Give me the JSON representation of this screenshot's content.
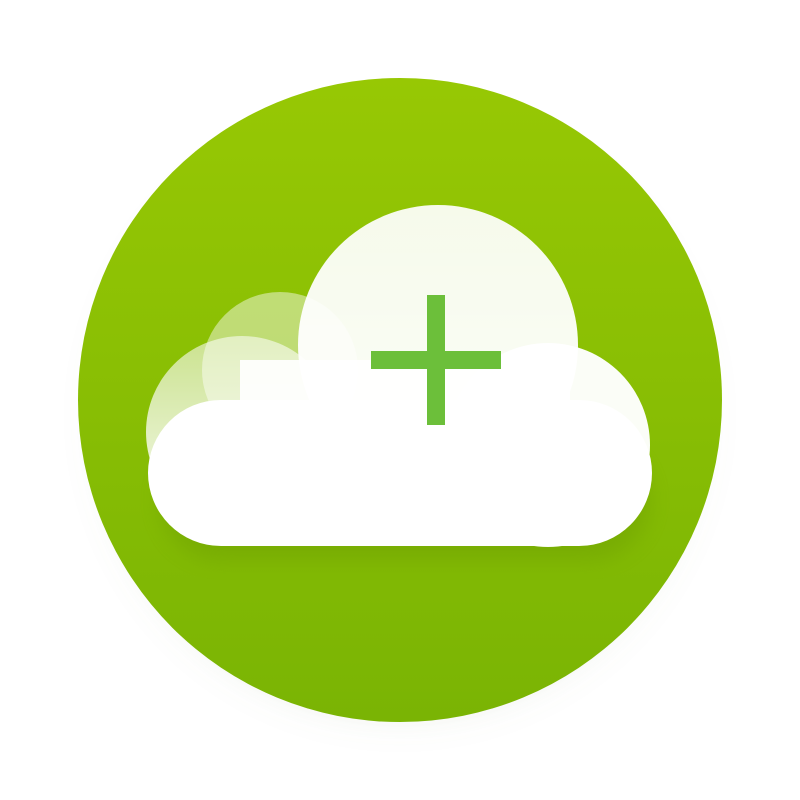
{
  "icon": {
    "name": "cloud-add-icon",
    "colors": {
      "circle_top": "#97c804",
      "circle_bottom": "#7ab404",
      "cloud": "#ffffff",
      "plus": "#6cbf3a",
      "shadow": "#8fa07a"
    }
  }
}
